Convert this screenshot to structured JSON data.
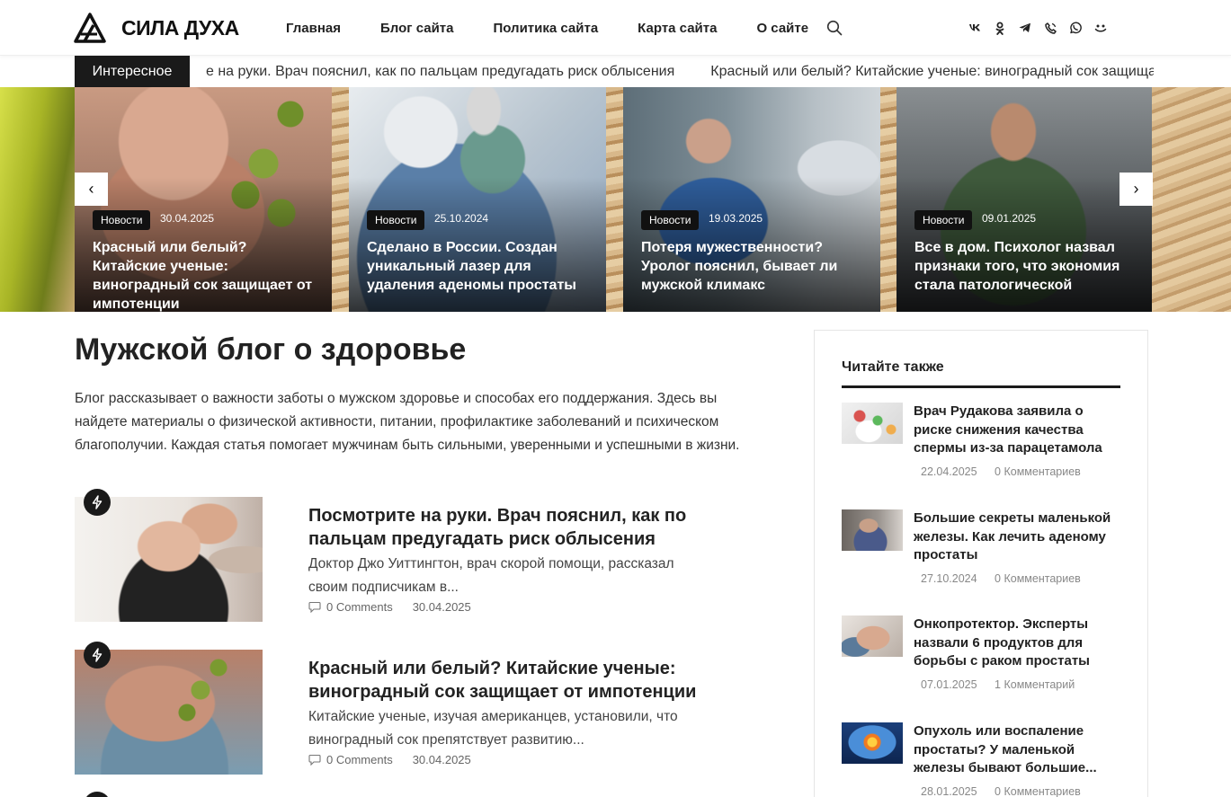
{
  "header": {
    "logo_text": "СИЛА ДУХА",
    "nav": [
      "Главная",
      "Блог сайта",
      "Политика сайта",
      "Карта сайта",
      "О сайте"
    ],
    "socials": [
      "vk-icon",
      "odnoklassniki-icon",
      "telegram-icon",
      "viber-icon",
      "whatsapp-icon",
      "max-icon"
    ]
  },
  "ticker": {
    "label": "Интересное",
    "items": [
      "е на руки. Врач пояснил, как по пальцам предугадать риск облысения",
      "Красный или белый? Китайские ученые: виноградный сок защищает от импотенции"
    ]
  },
  "slider": {
    "prev": "‹",
    "next": "›",
    "slides": [
      {
        "category": "Новости",
        "date": "30.04.2025",
        "title": "Красный или белый? Китайские ученые: виноградный сок защищает от импотенции"
      },
      {
        "category": "Новости",
        "date": "25.10.2024",
        "title": "Сделано в России. Создан уникальный лазер для удаления аденомы простаты"
      },
      {
        "category": "Новости",
        "date": "19.03.2025",
        "title": "Потеря мужественности? Уролог пояснил, бывает ли мужской климакс"
      },
      {
        "category": "Новости",
        "date": "09.01.2025",
        "title": "Все в дом. Психолог назвал признаки того, что экономия стала патологической"
      }
    ]
  },
  "main": {
    "title": "Мужской блог о здоровье",
    "description": "Блог рассказывает о важности заботы о мужском здоровье и способах его поддержания. Здесь вы найдете материалы о физической активности, питании, профилактике заболеваний и психическом благополучии. Каждая статья помогает мужчинам быть сильными, уверенными и успешными в жизни.",
    "posts": [
      {
        "title": "Посмотрите на руки. Врач пояснил, как по пальцам предугадать риск облысения",
        "excerpt": "Доктор Джо Уиттингтон, врач скорой помощи, рассказал своим подписчикам в...",
        "comments": "0 Comments",
        "date": "30.04.2025"
      },
      {
        "title": "Красный или белый? Китайские ученые: виноградный сок защищает от импотенции",
        "excerpt": "Китайские ученые, изучая американцев, установили, что виноградный сок препятствует развитию...",
        "comments": "0 Comments",
        "date": "30.04.2025"
      }
    ]
  },
  "sidebar": {
    "title": "Читайте также",
    "items": [
      {
        "title": "Врач Рудакова заявила о риске снижения качества спермы из-за парацетамола",
        "date": "22.04.2025",
        "comments": "0 Комментариев"
      },
      {
        "title": "Большие секреты маленькой железы. Как лечить аденому простаты",
        "date": "27.10.2024",
        "comments": "0 Комментариев"
      },
      {
        "title": "Онкопротектор. Эксперты назвали 6 продуктов для борьбы с раком простаты",
        "date": "07.01.2025",
        "comments": "1 Комментарий"
      },
      {
        "title": "Опухоль или воспаление простаты? У маленькой железы бывают большие...",
        "date": "28.01.2025",
        "comments": "0 Комментариев"
      }
    ]
  }
}
